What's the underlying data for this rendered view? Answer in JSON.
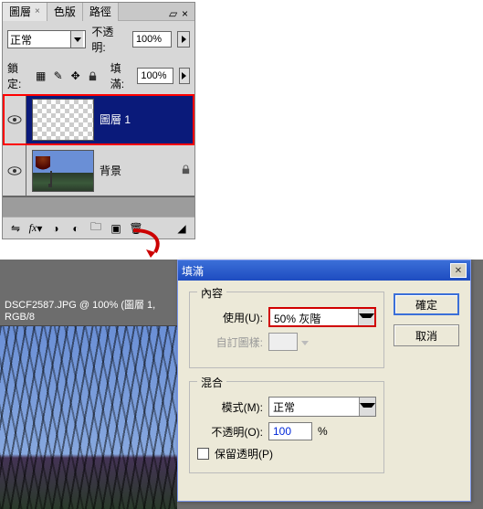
{
  "panel": {
    "tabs": {
      "layers": "圖層",
      "channels": "色版",
      "paths": "路徑"
    },
    "blendMode": "正常",
    "opacityLabel": "不透明:",
    "opacityValue": "100%",
    "lockLabel": "鎖定:",
    "fillLabel": "填滿:",
    "fillValue": "100%",
    "layer1": "圖層 1",
    "background": "背景"
  },
  "doc": {
    "title": "DSCF2587.JPG @ 100% (圖層 1, RGB/8"
  },
  "dialog": {
    "title": "填滿",
    "contentGroup": "內容",
    "useLabel": "使用(U):",
    "useValue": "50% 灰階",
    "patternLabel": "自訂圖樣:",
    "blendGroup": "混合",
    "modeLabel": "模式(M):",
    "modeValue": "正常",
    "opacityLabel": "不透明(O):",
    "opacityValue": "100",
    "opacityUnit": "%",
    "preserveLabel": "保留透明(P)",
    "ok": "確定",
    "cancel": "取消"
  }
}
